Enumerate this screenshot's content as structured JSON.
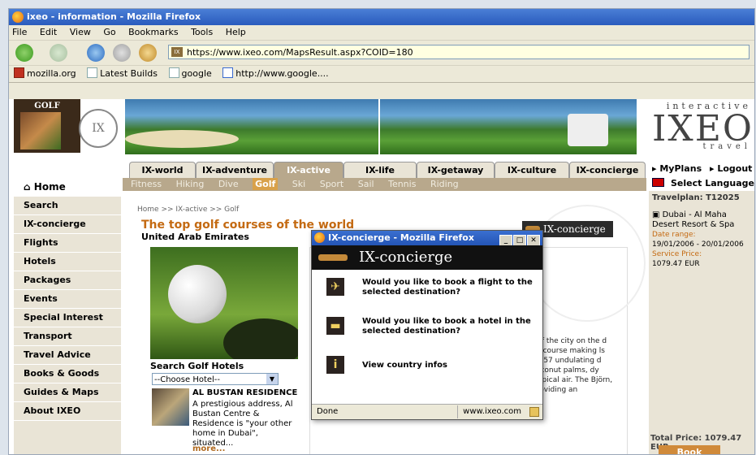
{
  "window": {
    "title": "ixeo - information - Mozilla Firefox"
  },
  "menu": [
    "File",
    "Edit",
    "View",
    "Go",
    "Bookmarks",
    "Tools",
    "Help"
  ],
  "address": {
    "url": "https://www.ixeo.com/MapsResult.aspx?COID=180"
  },
  "bookmarks": [
    "mozilla.org",
    "Latest Builds",
    "google",
    "http://www.google...."
  ],
  "header": {
    "golf_label": "GOLF",
    "seal_text": "IX",
    "brand_top": "interactive",
    "brand_main": "IXEO",
    "brand_bottom": "travel"
  },
  "tabs": [
    "IX-world",
    "IX-adventure",
    "IX-active",
    "IX-life",
    "IX-getaway",
    "IX-culture",
    "IX-concierge"
  ],
  "subnav": [
    "Fitness",
    "Hiking",
    "Dive",
    "Golf",
    "Ski",
    "Sport",
    "Sail",
    "Tennis",
    "Riding"
  ],
  "leftnav": [
    "Home",
    "Search",
    "IX-concierge",
    "Flights",
    "Hotels",
    "Packages",
    "Events",
    "Special Interest",
    "Transport",
    "Travel Advice",
    "Books & Goods",
    "Guides & Maps",
    "About IXEO"
  ],
  "main": {
    "breadcrumb": "Home  >>  IX-active >> Golf",
    "headline": "The top golf courses of the world",
    "country": "United Arab Emirates",
    "search_label": "Search Golf Hotels",
    "select_value": "--Choose Hotel--",
    "hotel_name": "AL BUSTAN RESIDENCE",
    "hotel_desc": "A prestigious address, Al Bustan Centre & Residence is \"your other home in Dubai\", situated...",
    "more": "more...",
    "badge": "IX-concierge",
    "bg_text": "t of the city on the d its course making ls 6,857 undulating d coconut palms, dy tropical air. The Björn, providing an"
  },
  "right": {
    "myplans": "MyPlans",
    "logout": "Logout",
    "language": "Select Language",
    "travelplan": "Travelplan: T12025",
    "hotel_title": "Dubai - Al Maha Desert Resort & Spa",
    "date_label": "Date range:",
    "date_value": "19/01/2006 - 20/01/2006",
    "price_label": "Service Price:",
    "price_value": "1079.47 EUR",
    "total": "Total Price: 1079.47 EUR",
    "book": "Book"
  },
  "popup": {
    "title": "IX-concierge - Mozilla Firefox",
    "header": "IX-concierge",
    "items": [
      "Would you like to book a flight to the selected destination?",
      "Would you like to book a hotel in the selected destination?",
      "View country infos"
    ],
    "status": "Done",
    "status_url": "www.ixeo.com"
  }
}
